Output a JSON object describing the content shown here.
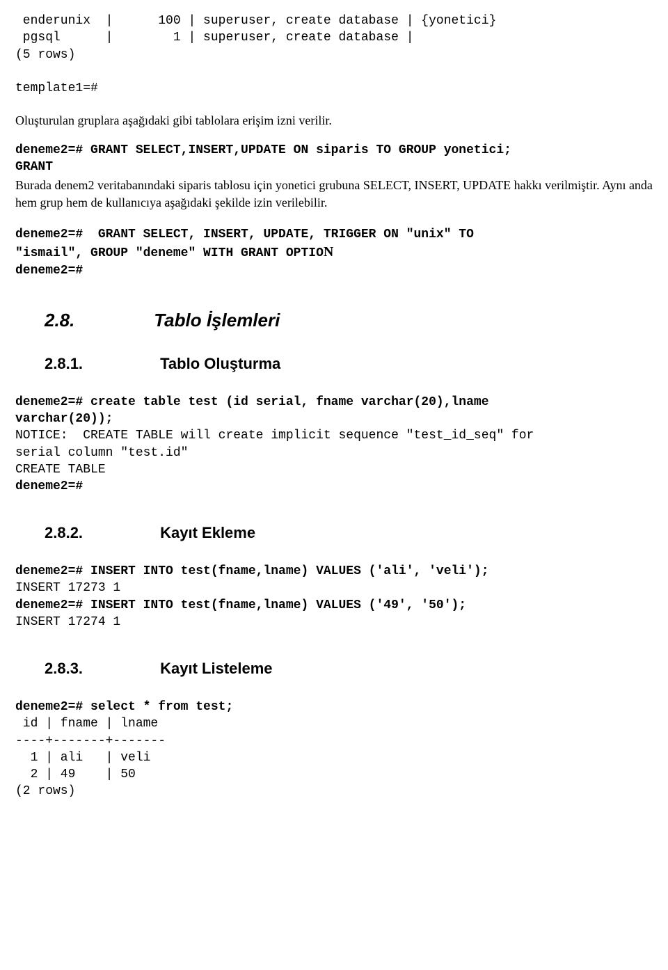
{
  "code_top": " enderunix  |      100 | superuser, create database | {yonetici}\n pgsql      |        1 | superuser, create database |\n(5 rows)\n\ntemplate1=#",
  "para1": "Oluşturulan gruplara aşağıdaki gibi tablolara erişim izni verilir.",
  "grant1_l1": "deneme2=# GRANT SELECT,INSERT,UPDATE ON siparis TO GROUP yonetici;",
  "grant1_l2": "GRANT",
  "para2": "Burada denem2 veritabanındaki siparis tablosu için yonetici grubuna SELECT, INSERT, UPDATE hakkı verilmiştir. Aynı anda hem grup hem de kullanıcıya aşağıdaki şekilde izin verilebilir.",
  "grant2_l1": "deneme2=#  GRANT SELECT, INSERT, UPDATE, TRIGGER ON \"unix\" TO",
  "grant2_l2_a": "\"ismail\", GROUP \"deneme\" WITH GRANT OPTIO",
  "grant2_l2_b": "N",
  "grant2_l3": "deneme2=#",
  "sect28_num": "2.8.",
  "sect28_title": "Tablo İşlemleri",
  "sub281_num": "2.8.1.",
  "sub281_title": "Tablo Oluşturma",
  "create_l1": "deneme2=# create table test (id serial, fname varchar(20),lname",
  "create_l2": "varchar(20));",
  "create_l3": "NOTICE:  CREATE TABLE will create implicit sequence \"test_id_seq\" for",
  "create_l4": "serial column \"test.id\"",
  "create_l5": "CREATE TABLE",
  "create_l6": "deneme2=#",
  "sub282_num": "2.8.2.",
  "sub282_title": "Kayıt Ekleme",
  "ins_l1": "deneme2=# INSERT INTO test(fname,lname) VALUES ('ali', 'veli');",
  "ins_l2": "INSERT 17273 1",
  "ins_l3": "deneme2=# INSERT INTO test(fname,lname) VALUES ('49', '50');",
  "ins_l4": "INSERT 17274 1",
  "sub283_num": "2.8.3.",
  "sub283_title": "Kayıt Listeleme",
  "sel_l1": "deneme2=# select * from test;",
  "sel_l2": " id | fname | lname",
  "sel_l3": "----+-------+-------",
  "sel_l4": "  1 | ali   | veli",
  "sel_l5": "  2 | 49    | 50",
  "sel_l6": "(2 rows)"
}
